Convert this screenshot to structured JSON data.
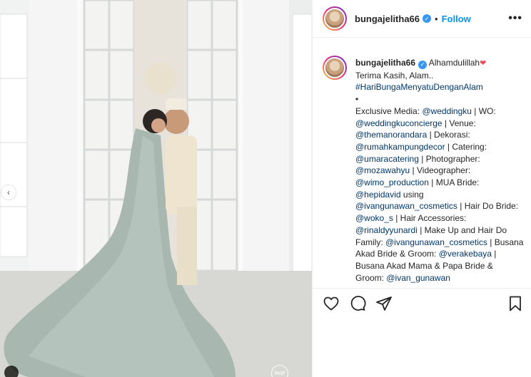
{
  "post": {
    "username": "bungajelitha66",
    "verified_mark": "✓",
    "separator": "•",
    "follow_label": "Follow",
    "more_label": "•••",
    "caption": {
      "username": "bungajelitha66",
      "line1": "Alhamdulillah",
      "heart_icon": "❤",
      "line2": "Terima Kasih, Alam..",
      "hashtag": "#HariBungaMenyatuDenganAlam",
      "bullet": "•",
      "segments": [
        {
          "t": "Exclusive Media: "
        },
        {
          "t": "@weddingku",
          "tag": true
        },
        {
          "t": " | WO: "
        },
        {
          "t": "@weddingkuconcierge",
          "tag": true
        },
        {
          "t": " | Venue: "
        },
        {
          "t": "@themanorandara",
          "tag": true
        },
        {
          "t": " | Dekorasi: "
        },
        {
          "t": "@rumahkampungdecor",
          "tag": true
        },
        {
          "t": " | Catering: "
        },
        {
          "t": "@umaracatering",
          "tag": true
        },
        {
          "t": " | Photographer: "
        },
        {
          "t": "@mozawahyu",
          "tag": true
        },
        {
          "t": " | Videographer: "
        },
        {
          "t": "@wimo_production",
          "tag": true
        },
        {
          "t": " | MUA Bride: "
        },
        {
          "t": "@hepidavid",
          "tag": true
        },
        {
          "t": " using "
        },
        {
          "t": "@ivangunawan_cosmetics",
          "tag": true
        },
        {
          "t": " | Hair Do Bride: "
        },
        {
          "t": "@woko_s",
          "tag": true
        },
        {
          "t": " | Hair Accessories: "
        },
        {
          "t": "@rinaldyyunardi",
          "tag": true
        },
        {
          "t": " | Make Up and Hair Do Family: "
        },
        {
          "t": "@ivangunawan_cosmetics",
          "tag": true
        },
        {
          "t": " | Busana Akad Bride & Groom: "
        },
        {
          "t": "@verakebaya",
          "tag": true
        },
        {
          "t": " | Busana Akad Mama & Papa Bride & Groom: "
        },
        {
          "t": "@ivan_gunawan",
          "tag": true
        }
      ]
    },
    "photo": {
      "nav_left": "‹",
      "watermark": "MdP"
    }
  },
  "colors": {
    "link": "#00376b",
    "follow": "#0095f6",
    "verified": "#3897f0"
  },
  "icons": [
    "heart-icon",
    "comment-icon",
    "share-icon",
    "bookmark-icon"
  ]
}
